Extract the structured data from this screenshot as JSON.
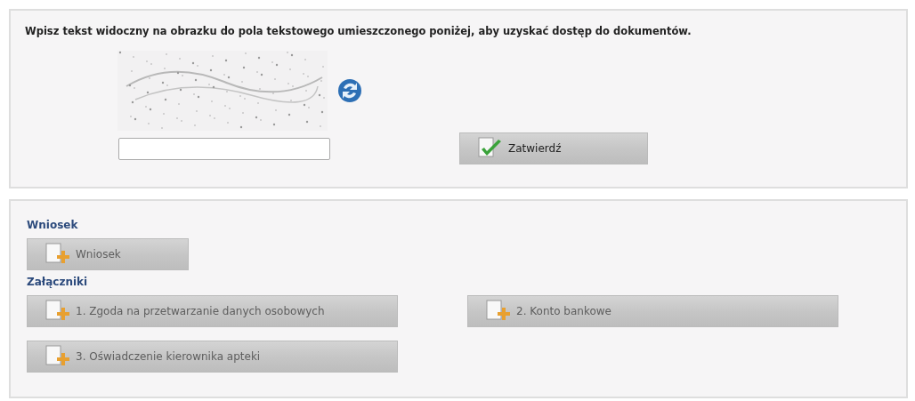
{
  "captcha": {
    "instruction": "Wpisz tekst widoczny na obrazku do pola tekstowego umieszczonego poniżej, aby uzyskać dostęp do dokumentów.",
    "submit": {
      "label": "Zatwierdź",
      "disabled": false
    }
  },
  "documents": {
    "sections": [
      {
        "heading": "Wniosek",
        "buttons": [
          {
            "label": "Wniosek",
            "disabled": true
          }
        ]
      },
      {
        "heading": "Załączniki",
        "buttons": [
          {
            "label": "1. Zgoda na przetwarzanie danych osobowych",
            "disabled": true
          },
          {
            "label": "2. Konto bankowe",
            "disabled": true
          },
          {
            "label": "3. Oświadczenie kierownika apteki",
            "disabled": true
          }
        ]
      }
    ]
  }
}
